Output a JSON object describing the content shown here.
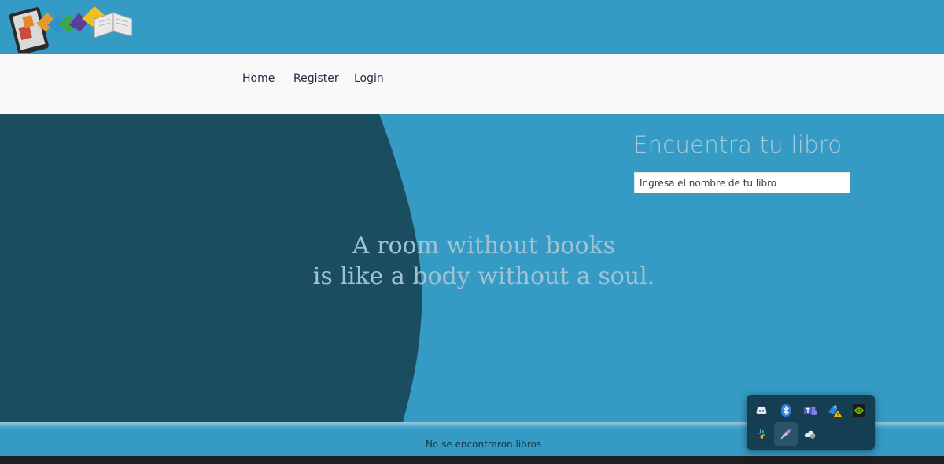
{
  "header": {
    "logo_icon": "books-and-tablet-logo"
  },
  "nav": {
    "home": "Home",
    "register": "Register",
    "login": "Login"
  },
  "hero": {
    "quote_line1": "A room without books",
    "quote_line2": "is like a body without a soul."
  },
  "search": {
    "title": "Encuentra tu libro",
    "placeholder": "Ingresa el nombre de tu libro",
    "value": ""
  },
  "results": {
    "empty_message": "No se encontraron libros"
  },
  "tray": {
    "icons": [
      "discord-icon",
      "bluetooth-icon",
      "teams-icon",
      "onedrive-warning-icon",
      "nvidia-icon",
      "slack-icon",
      "feather-icon",
      "cloud-sync-icon"
    ]
  },
  "colors": {
    "primary_blue": "#359bc4",
    "dark_teal": "#1b4d61",
    "nav_bg": "#f9f9f9"
  }
}
